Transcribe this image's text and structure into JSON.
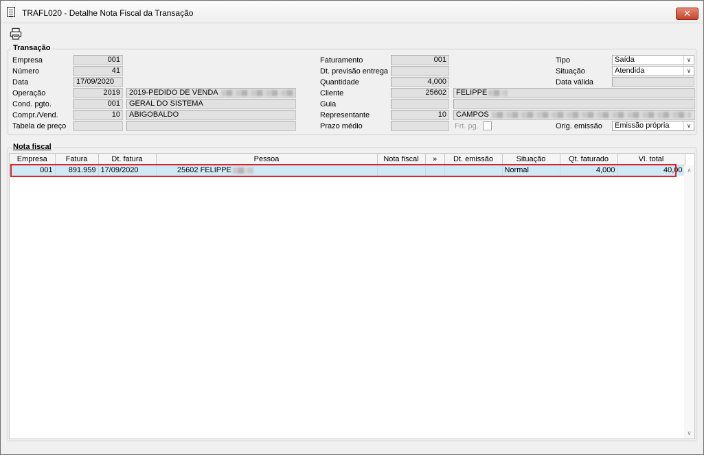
{
  "window": {
    "title": "TRAFL020 - Detalhe Nota Fiscal da Transação",
    "close_label": "✕"
  },
  "transacao": {
    "section_title": "Transação",
    "empresa": {
      "label": "Empresa",
      "value": "001"
    },
    "numero": {
      "label": "Número",
      "value": "41"
    },
    "data": {
      "label": "Data",
      "value": "17/09/2020"
    },
    "operacao": {
      "label": "Operação",
      "code": "2019",
      "desc": "2019-PEDIDO DE VENDA"
    },
    "cond_pgto": {
      "label": "Cond. pgto.",
      "code": "001",
      "desc": "GERAL DO SISTEMA"
    },
    "compr_vend": {
      "label": "Compr./Vend.",
      "code": "10",
      "desc": "ABIGOBALDO"
    },
    "tabela_preco": {
      "label": "Tabela de preço",
      "code": "",
      "desc": ""
    },
    "faturamento": {
      "label": "Faturamento",
      "value": "001"
    },
    "dt_previsao": {
      "label": "Dt. previsão entrega",
      "value": ""
    },
    "quantidade": {
      "label": "Quantidade",
      "value": "4,000"
    },
    "cliente": {
      "label": "Cliente",
      "code": "25602",
      "desc": "FELIPPE"
    },
    "guia": {
      "label": "Guia",
      "code": "",
      "desc": ""
    },
    "representante": {
      "label": "Representante",
      "code": "10",
      "desc": "CAMPOS"
    },
    "prazo_medio": {
      "label": "Prazo médio",
      "value": ""
    },
    "frt_pg": {
      "label": "Frt. pg."
    },
    "tipo": {
      "label": "Tipo",
      "value": "Saída"
    },
    "situacao": {
      "label": "Situação",
      "value": "Atendida"
    },
    "data_valida": {
      "label": "Data válida",
      "value": ""
    },
    "orig_emissao": {
      "label": "Orig. emissão",
      "value": "Emissão própria"
    }
  },
  "nota_fiscal": {
    "section_title": "Nota fiscal",
    "columns": [
      "Empresa",
      "Fatura",
      "Dt. fatura",
      "Pessoa",
      "Nota fiscal",
      "»",
      "Dt. emissão",
      "Situação",
      "Qt. faturado",
      "Vl. total"
    ],
    "row": {
      "empresa": "001",
      "fatura": "891.959",
      "dt_fatura": "17/09/2020",
      "pessoa_code": "25602",
      "pessoa_name": "FELIPPE",
      "nota_fiscal": "",
      "flag": "",
      "dt_emissao": "",
      "situacao": "Normal",
      "qt_faturado": "4,000",
      "vl_total": "40,00"
    }
  },
  "icons": {
    "print": "printer-icon",
    "document": "document-icon"
  },
  "colors": {
    "selected_row": "#cfeaf7",
    "highlight_outline": "#e0202a",
    "close_button": "#c8432b"
  }
}
